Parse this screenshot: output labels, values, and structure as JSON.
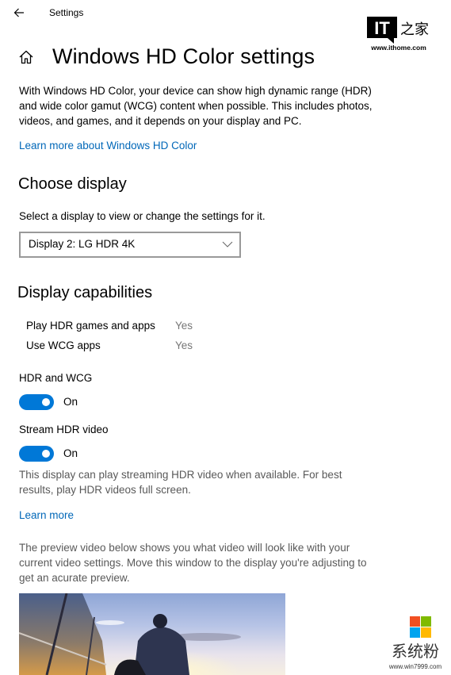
{
  "titlebar": {
    "back_icon": "back-arrow-icon",
    "title": "Settings"
  },
  "page": {
    "home_icon": "home-icon",
    "title": "Windows HD Color settings",
    "intro": "With Windows HD Color, your device can show high dynamic range (HDR) and wide color gamut (WCG) content when possible. This includes photos, videos, and games, and it depends on your display and PC.",
    "learn_more_hd": "Learn more about Windows HD Color"
  },
  "choose_display": {
    "heading": "Choose display",
    "label": "Select a display to view or change the settings for it.",
    "selected": "Display 2: LG HDR 4K",
    "chevron_icon": "chevron-down-icon"
  },
  "capabilities": {
    "heading": "Display capabilities",
    "rows": [
      {
        "label": "Play HDR games and apps",
        "value": "Yes"
      },
      {
        "label": "Use WCG apps",
        "value": "Yes"
      }
    ]
  },
  "hdr_wcg": {
    "label": "HDR and WCG",
    "state": "On",
    "enabled": true
  },
  "stream_hdr": {
    "label": "Stream HDR video",
    "state": "On",
    "enabled": true,
    "description": "This display can play streaming HDR video when available. For best results, play HDR videos full screen.",
    "learn_more": "Learn more",
    "preview_text": "The preview video below shows you what video will look like with your current video settings. Move this window to the display you're adjusting to get an acurate preview."
  },
  "watermarks": {
    "ithome_text": "IT",
    "ithome_cn": "之家",
    "ithome_url": "www.ithome.com",
    "win7999_cn": "系统粉",
    "win7999_url": "www.win7999.com"
  },
  "colors": {
    "accent": "#0078d7",
    "link": "#0067b8",
    "secondary_text": "#767676"
  }
}
